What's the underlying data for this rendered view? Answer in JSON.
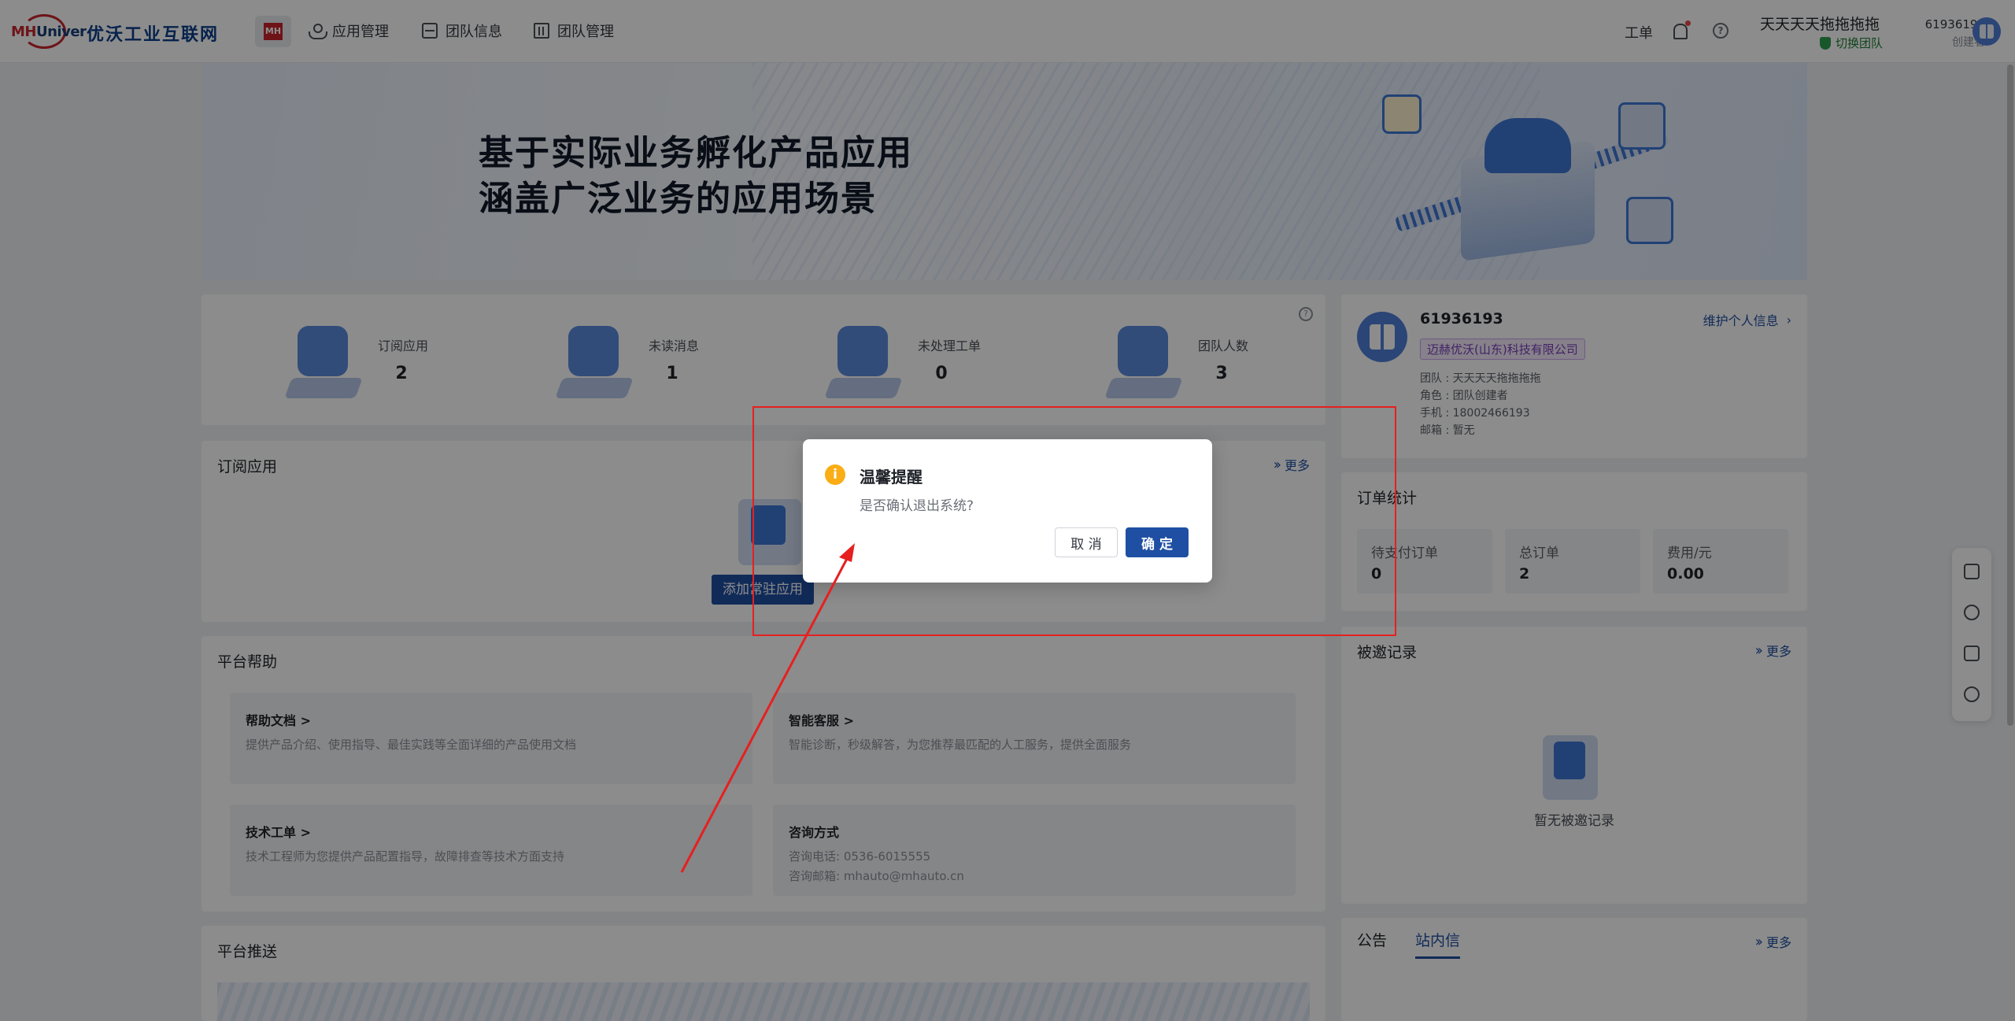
{
  "logo": {
    "text_a": "MH",
    "text_b": "Univer"
  },
  "brand": "优沃工业互联网",
  "nav": {
    "mh_badge": "MH",
    "items": [
      {
        "label": "应用管理",
        "icon": "apps-icon"
      },
      {
        "label": "团队信息",
        "icon": "team-info-icon"
      },
      {
        "label": "团队管理",
        "icon": "building-icon"
      }
    ]
  },
  "top_right": {
    "ticket": "工单",
    "team_name": "天天天天拖拖拖拖",
    "switch_team": "切换团队",
    "user_id": "61936193",
    "role": "创建者"
  },
  "banner": {
    "line1": "基于实际业务孵化产品应用",
    "line2": "涵盖广泛业务的应用场景"
  },
  "stats": [
    {
      "label": "订阅应用",
      "value": "2"
    },
    {
      "label": "未读消息",
      "value": "1"
    },
    {
      "label": "未处理工单",
      "value": "0"
    },
    {
      "label": "团队人数",
      "value": "3"
    }
  ],
  "subscriptions": {
    "title": "订阅应用",
    "more": "更多",
    "add_button": "添加常驻应用"
  },
  "platform_help": {
    "title": "平台帮助",
    "tiles": [
      {
        "title": "帮助文档 >",
        "desc": [
          "提供产品介绍、使用指导、最佳实践等全面详细的产品使用文档"
        ]
      },
      {
        "title": "智能客服 >",
        "desc": [
          "智能诊断，秒级解答，为您推荐最匹配的人工服务，提供全面服务"
        ]
      },
      {
        "title": "技术工单 >",
        "desc": [
          "技术工程师为您提供产品配置指导，故障排查等技术方面支持"
        ]
      },
      {
        "title": "咨询方式",
        "desc": [
          "咨询电话: 0536-6015555",
          "咨询邮箱: mhauto@mhauto.cn"
        ]
      }
    ]
  },
  "platform_push": {
    "title": "平台推送"
  },
  "profile": {
    "name": "61936193",
    "maintain": "维护个人信息",
    "company": "迈赫优沃(山东)科技有限公司",
    "team": "团队 : 天天天天拖拖拖拖",
    "role": "角色 : 团队创建者",
    "phone": "手机 : 18002466193",
    "email": "邮箱 : 暂无"
  },
  "orders": {
    "title": "订单统计",
    "boxes": [
      {
        "label": "待支付订单",
        "value": "0"
      },
      {
        "label": "总订单",
        "value": "2"
      },
      {
        "label": "费用/元",
        "value": "0.00"
      }
    ]
  },
  "invites": {
    "title": "被邀记录",
    "more": "更多",
    "empty": "暂无被邀记录"
  },
  "notices": {
    "tabs": [
      "公告",
      "站内信"
    ],
    "active": "站内信",
    "more": "更多"
  },
  "modal": {
    "title": "温馨提醒",
    "content": "是否确认退出系统?",
    "cancel": "取 消",
    "ok": "确 定",
    "icon": "warning-icon"
  },
  "colors": {
    "accent": "#1f4fa3",
    "brand_red": "#c8262c",
    "annotation_red": "#e62020",
    "warn": "#faad14"
  }
}
